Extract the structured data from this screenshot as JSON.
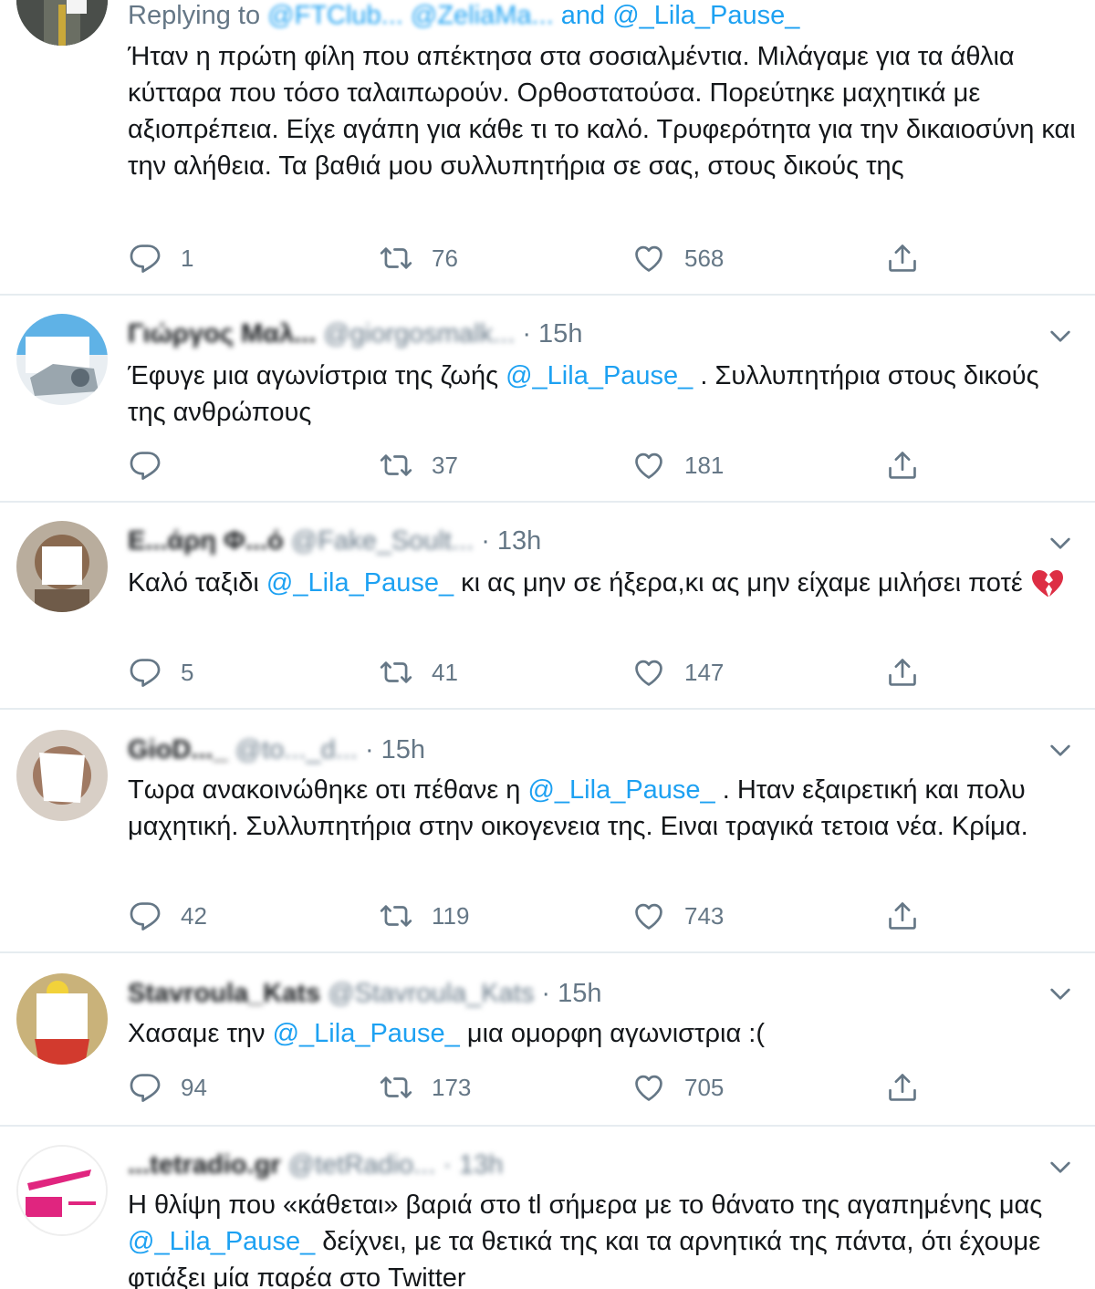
{
  "colors": {
    "accent": "#1da1f2",
    "muted": "#657786",
    "text": "#14171a",
    "divider": "#e6ecf0"
  },
  "top_reply": {
    "replying_prefix": "Replying to",
    "replying_handle_1": "@FTClub...",
    "replying_handle_2": "@ZeliaMa...",
    "replying_and": "and",
    "replying_handle_3": "@_Lila_Pause_",
    "text": "Ήταν η πρώτη φίλη που απέκτησα στα σοσιαλμέντια. Μιλάγαμε για τα άθλια κύτταρα που τόσο ταλαιπωρούν. Ορθοστατούσα. Πορεύτηκε μαχητικά με αξιοπρέπεια. Είχε αγάπη για κάθε τι το καλό. Τρυφερότητα για την δικαιοσύνη και την αλήθεια. Τα βαθιά μου συλλυπητήρια σε σας, στους δικούς της",
    "replies": "1",
    "retweets": "76",
    "likes": "568"
  },
  "tweets": [
    {
      "name": "Γιώργος Μαλ...",
      "handle": "@giorgosmalk...",
      "time": "· 15h",
      "text_before": "Έφυγε μια αγωνίστρια της ζωής ",
      "mention": "@_Lila_Pause_",
      "text_after": " . Συλλυπητήρια στους δικούς της ανθρώπους",
      "replies": "",
      "retweets": "37",
      "likes": "181"
    },
    {
      "name": "Ε...άρη Φ...ό",
      "handle": "@Fake_Soult...",
      "time": "· 13h",
      "text_before": "Καλό ταξιδι ",
      "mention": "@_Lila_Pause_",
      "text_after": "  κι ας μην σε ήξερα,κι ας μην είχαμε μιλήσει ποτέ ",
      "emoji": "broken-heart-icon",
      "replies": "5",
      "retweets": "41",
      "likes": "147"
    },
    {
      "name": "GioD..._",
      "handle": "@to..._d...",
      "time": "· 15h",
      "text_before": "Τωρα ανακοινώθηκε οτι πέθανε η ",
      "mention": "@_Lila_Pause_",
      "text_after": " . Ηταν εξαιρετική και πολυ μαχητική. Συλλυπητήρια στην οικογενεια της. Ειναι τραγικά τετοια νέα. Κρίμα.",
      "replies": "42",
      "retweets": "119",
      "likes": "743"
    },
    {
      "name": "Stavroula_Kats",
      "handle": "@Stavroula_Kats",
      "time": "· 15h",
      "text_before": "Χασαμε την ",
      "mention": "@_Lila_Pause_",
      "text_after": "  μια ομορφη αγωνιστρια :(",
      "replies": "94",
      "retweets": "173",
      "likes": "705"
    },
    {
      "name": "...tetradio.gr",
      "handle": "@tetRadio...",
      "time": "· 13h",
      "text_before": "Η θλίψη που «κάθεται» βαριά στο tl σήμερα με το θάνατο της αγαπημένης μας ",
      "mention": "@_Lila_Pause_",
      "text_after": " δείχνει, με τα θετικά της και τα αρνητικά της πάντα, ότι έχουμε φτιάξει μία παρέα στο Twitter",
      "replies": "",
      "retweets": "",
      "likes": ""
    }
  ]
}
